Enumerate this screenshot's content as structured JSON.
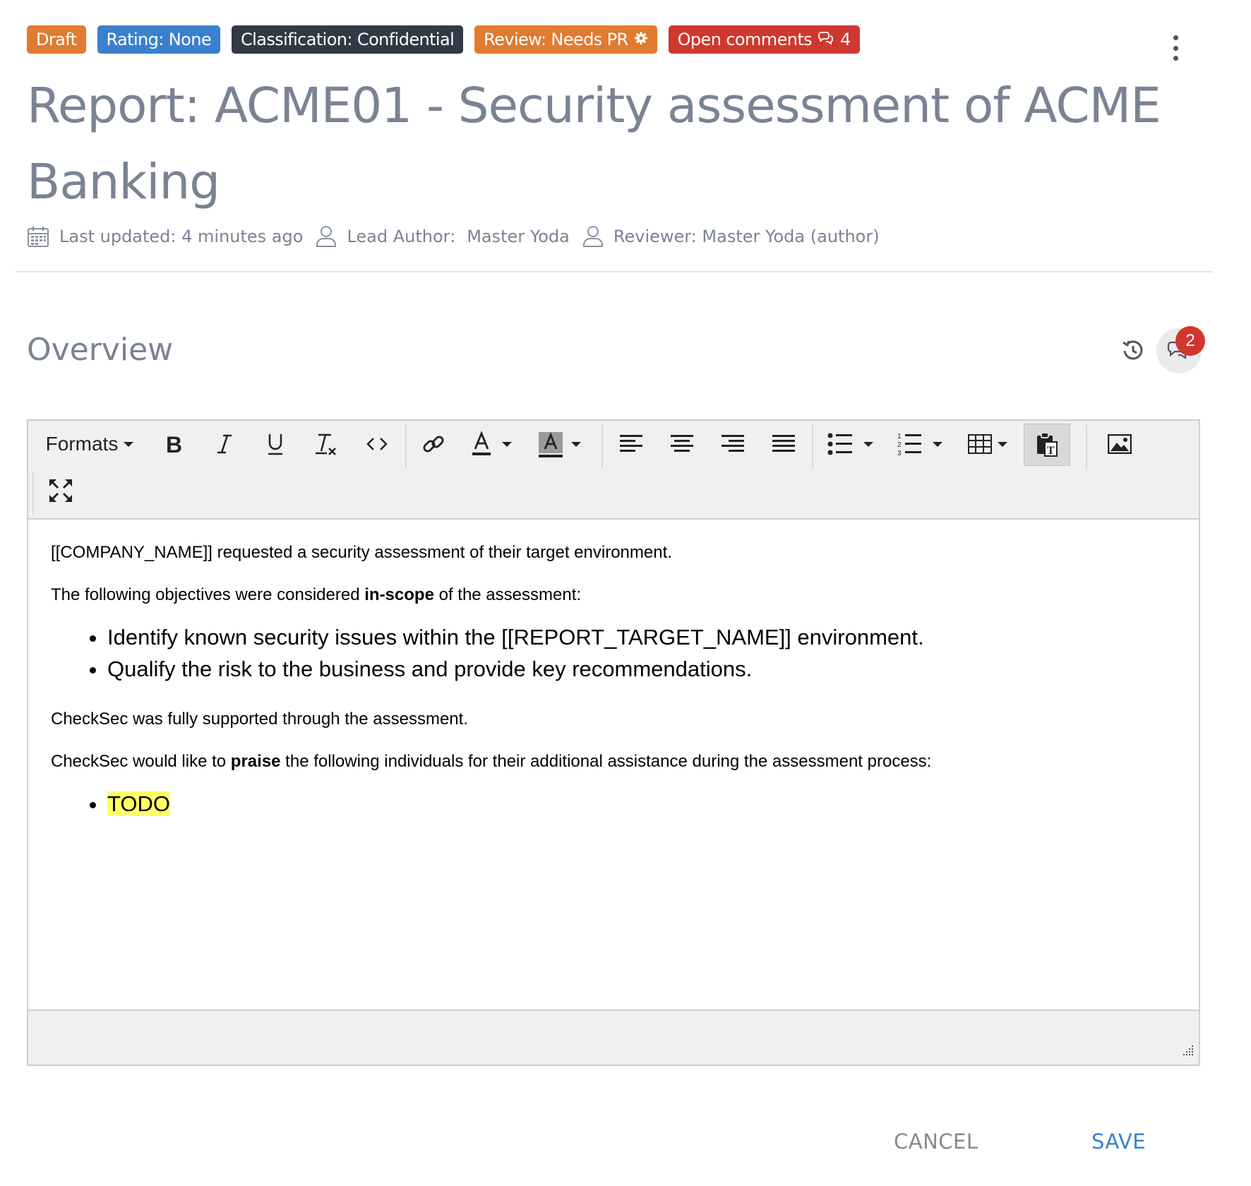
{
  "badges": {
    "draft": "Draft",
    "rating": "Rating: None",
    "classification": "Classification: Confidential",
    "review": "Review: Needs PR",
    "open_comments": "Open comments",
    "open_comments_count": "4"
  },
  "title": "Report: ACME01 - Security assessment of ACME Banking",
  "meta": {
    "last_updated": "Last updated: 4 minutes ago",
    "lead_author_label": "Lead Author:",
    "lead_author_name": "Master Yoda",
    "reviewer": "Reviewer: Master Yoda (author)"
  },
  "section": {
    "title": "Overview",
    "comment_count": "2"
  },
  "toolbar": {
    "formats_label": "Formats"
  },
  "content": {
    "p1": "[[COMPANY_NAME]] requested a security assessment of their target environment.",
    "p2_pre": "The following objectives were considered ",
    "p2_bold": "in-scope",
    "p2_post": " of the assessment:",
    "objectives": [
      "Identify known security issues within the [[REPORT_TARGET_NAME]] environment.",
      "Qualify the risk to the business and provide key recommendations."
    ],
    "p3": "CheckSec was fully supported through the assessment.",
    "p4_pre": "CheckSec would like to ",
    "p4_bold": "praise",
    "p4_post": " the following individuals for their additional assistance during the assessment process:",
    "todo": "TODO"
  },
  "actions": {
    "cancel": "CANCEL",
    "save": "SAVE"
  },
  "colors": {
    "draft": "#e07b30",
    "rating": "#3b80ce",
    "classification": "#323946",
    "review": "#e07b30",
    "comments": "#d0372e",
    "title_text": "#7a8394",
    "highlight": "#ffff66"
  }
}
